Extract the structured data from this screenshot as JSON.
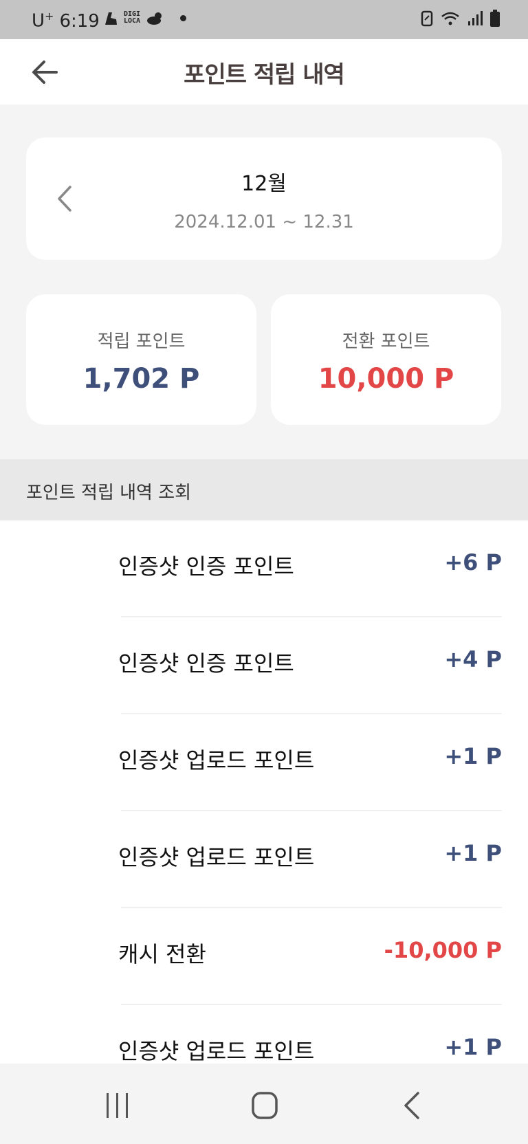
{
  "status_bar": {
    "carrier": "U",
    "carrier_sup": "+",
    "time": "6:19",
    "app_badge_line1": "DIGI",
    "app_badge_line2": "LOCA"
  },
  "header": {
    "title": "포인트 적립 내역"
  },
  "month_selector": {
    "month": "12월",
    "range": "2024.12.01 ~ 12.31"
  },
  "summary": {
    "earned_label": "적립 포인트",
    "earned_value": "1,702 P",
    "converted_label": "전환 포인트",
    "converted_value": "10,000 P"
  },
  "history": {
    "section_title": "포인트 적립 내역 조회",
    "items": [
      {
        "label": "인증샷 인증 포인트",
        "amount": "+6 P"
      },
      {
        "label": "인증샷 인증 포인트",
        "amount": "+4 P"
      },
      {
        "label": "인증샷 업로드 포인트",
        "amount": "+1 P"
      },
      {
        "label": "인증샷 업로드 포인트",
        "amount": "+1 P"
      },
      {
        "label": "캐시 전환",
        "amount": "-10,000 P"
      },
      {
        "label": "인증샷 업로드 포인트",
        "amount": "+1 P"
      }
    ]
  },
  "colors": {
    "positive": "#3e4f7a",
    "negative": "#e24646"
  },
  "icons": {
    "back": "arrow-left-icon",
    "prev_month": "chevron-left-icon",
    "nav_recent": "recent-apps-icon",
    "nav_home": "home-icon",
    "nav_back": "back-icon"
  }
}
